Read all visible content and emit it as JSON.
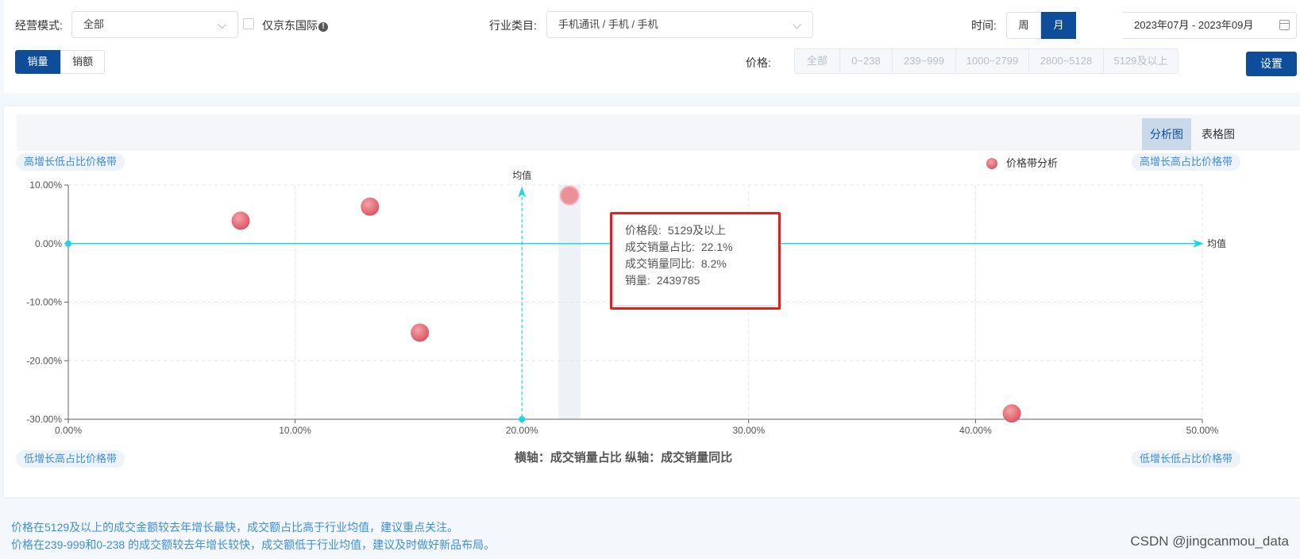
{
  "filters": {
    "mode_label": "经营模式:",
    "mode_value": "全部",
    "jd_intl_label": "仅京东国际",
    "industry_label": "行业类目:",
    "industry_value": "手机通讯 / 手机 / 手机",
    "time_label": "时间:",
    "time_week": "周",
    "time_month": "月",
    "date_range": "2023年07月 - 2023年09月",
    "metric_tabs": [
      "销量",
      "销额"
    ],
    "price_label": "价格:",
    "price_options": [
      "全部",
      "0~238",
      "239~999",
      "1000~2799",
      "2800~5128",
      "5129及以上"
    ],
    "settings_label": "设置"
  },
  "view_tabs": {
    "analysis": "分析图",
    "table": "表格图"
  },
  "quadrants": {
    "top_left": "高增长低占比价格带",
    "top_right": "高增长高占比价格带",
    "bottom_left": "低增长高占比价格带",
    "bottom_right": "低增长低占比价格带"
  },
  "tooltip": {
    "rows": [
      {
        "k": "价格段:",
        "v": "5129及以上"
      },
      {
        "k": "成交销量占比:",
        "v": "22.1%"
      },
      {
        "k": "成交销量同比:",
        "v": "8.2%"
      },
      {
        "k": "销量:",
        "v": "2439785"
      }
    ]
  },
  "notes": [
    "价格在5129及以上的成交金额较去年增长最快，成交额占比高于行业均值，建议重点关注。",
    "价格在239-999和0-238 的成交额较去年增长较快，成交额低于行业均值，建议及时做好新品布局。"
  ],
  "watermark": "CSDN @jingcanmou_data",
  "colors": {
    "brand": "#0d4d99",
    "bubble": "#e5707c",
    "mean_line": "#19d7e6",
    "tag_text": "#3d8fe0",
    "highlight": "#e5211d"
  },
  "chart_data": {
    "type": "scatter",
    "xlabel": "横轴：成交销量占比  纵轴：成交销量同比",
    "legend": "价格带分析",
    "legend_position": "top-right",
    "xlim": [
      0,
      50
    ],
    "ylim": [
      -30,
      10
    ],
    "x_ticks": [
      "0.00%",
      "10.00%",
      "20.00%",
      "30.00%",
      "40.00%",
      "50.00%"
    ],
    "y_ticks": [
      "10.00%",
      "0.00%",
      "-10.00%",
      "-20.00%",
      "-30.00%"
    ],
    "mean_label": "均值",
    "mean_x": 20,
    "mean_y": 0,
    "grid": true,
    "series": [
      {
        "name": "价格带分析",
        "points": [
          {
            "x": 7.6,
            "y": 3.9
          },
          {
            "x": 13.3,
            "y": 6.3
          },
          {
            "x": 15.5,
            "y": -15.2
          },
          {
            "x": 22.1,
            "y": 8.2
          },
          {
            "x": 41.6,
            "y": -29.0
          }
        ]
      }
    ],
    "highlight_x": 22.1
  }
}
